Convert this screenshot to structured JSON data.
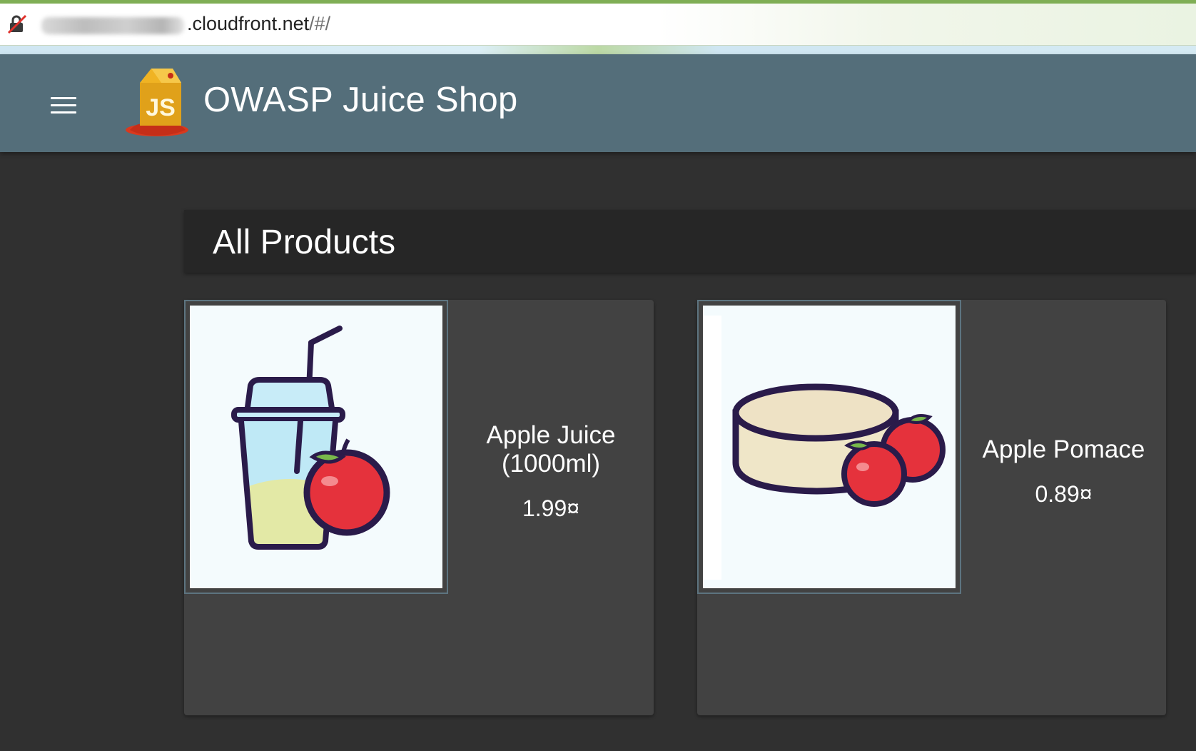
{
  "browser": {
    "url_host_suffix": ".cloudfront.net",
    "url_path": "/#/",
    "insecure_icon": "lock-slash-icon"
  },
  "header": {
    "menu_icon": "menu-icon",
    "logo_text": "JS",
    "title": "OWASP Juice Shop"
  },
  "main": {
    "heading": "All Products",
    "products": [
      {
        "name_line1": "Apple Juice",
        "name_line2": "(1000ml)",
        "price": "1.99¤",
        "image_icon": "juice-cup-apple-icon"
      },
      {
        "name_line1": "Apple Pomace",
        "name_line2": "",
        "price": "0.89¤",
        "image_icon": "pomace-apples-icon"
      }
    ]
  },
  "colors": {
    "toolbar": "#546e7a",
    "background": "#303030",
    "card": "#424242",
    "heading_card": "#262626"
  }
}
